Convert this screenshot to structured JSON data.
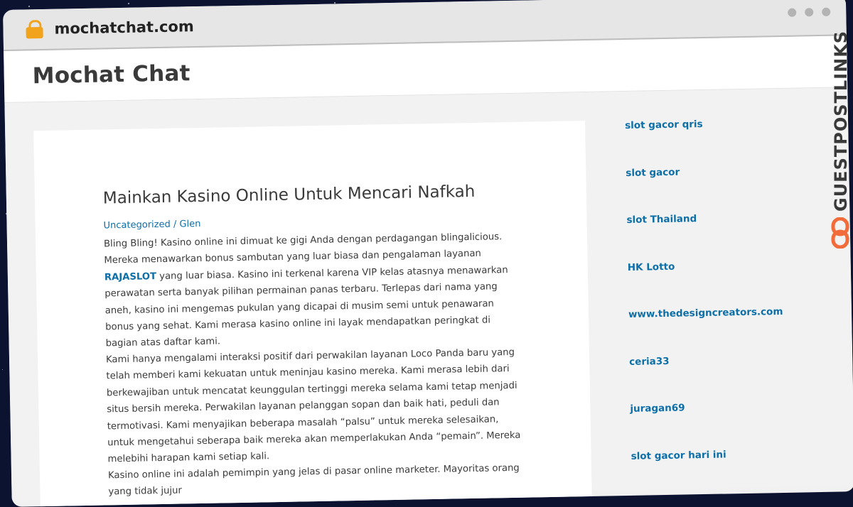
{
  "browser": {
    "url": "mochatchat.com"
  },
  "site": {
    "title": "Mochat Chat"
  },
  "post": {
    "title": "Mainkan Kasino Online Untuk Mencari Nafkah",
    "category": "Uncategorized",
    "separator": "/",
    "author": "Glen",
    "p1_before": "Bling Bling! Kasino online ini dimuat ke gigi Anda dengan perdagangan blingalicious. Mereka menawarkan bonus sambutan yang luar biasa dan pengalaman layanan ",
    "p1_link": "RAJASLOT",
    "p1_after": " yang luar biasa. Kasino ini terkenal karena VIP kelas atasnya menawarkan perawatan serta banyak pilihan permainan panas terbaru. Terlepas dari nama yang aneh, kasino ini mengemas pukulan yang dicapai di musim semi untuk penawaran bonus yang sehat. Kami merasa kasino online ini layak mendapatkan peringkat di bagian atas daftar kami.",
    "p2": "Kami hanya mengalami interaksi positif dari perwakilan layanan Loco Panda baru yang telah memberi kami kekuatan untuk meninjau kasino mereka. Kami merasa lebih dari berkewajiban untuk mencatat keunggulan tertinggi mereka selama kami tetap menjadi situs bersih mereka. Perwakilan layanan pelanggan sopan dan baik hati, peduli dan termotivasi. Kami menyajikan beberapa masalah “palsu” untuk mereka selesaikan, untuk mengetahui seberapa baik mereka akan memperlakukan Anda “pemain”. Mereka melebihi harapan kami setiap kali.",
    "p3": "Kasino online ini adalah pemimpin yang jelas di pasar online marketer. Mayoritas orang yang tidak jujur"
  },
  "sidebar": {
    "links": [
      "slot gacor qris",
      "slot gacor",
      "slot Thailand",
      "HK Lotto",
      "www.thedesigncreators.com",
      "ceria33",
      "juragan69",
      "slot gacor hari ini"
    ]
  },
  "brand": {
    "name": "GUESTPOSTLINKS",
    "icon": "link-icon"
  },
  "colors": {
    "background": "#0c1330",
    "link": "#0d6fa8",
    "lock": "#f2a31c",
    "brand_icon": "#f26b3a"
  }
}
